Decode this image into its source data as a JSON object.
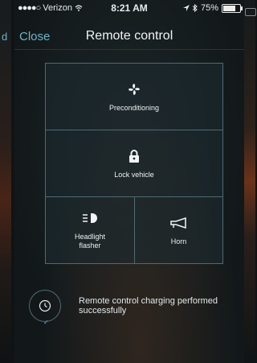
{
  "status_bar": {
    "signal": "●●●●○",
    "carrier": "Verizon",
    "time": "8:21 AM",
    "battery": "75%",
    "battery_level": 0.75
  },
  "left_edge": {
    "partial_label": "d"
  },
  "nav": {
    "close_label": "Close",
    "title": "Remote control"
  },
  "tiles": [
    {
      "label": "Preconditioning",
      "icon": "fan-icon"
    },
    {
      "label": "Lock vehicle",
      "icon": "lock-icon"
    },
    {
      "label": "Headlight\nflasher",
      "icon": "headlight-icon"
    },
    {
      "label": "Horn",
      "icon": "horn-icon"
    }
  ],
  "notice": {
    "icon": "clock-icon",
    "check": "✓",
    "message": "Remote control charging performed successfully"
  },
  "colors": {
    "accent": "#6bb5c9",
    "border": "#4f6a74"
  }
}
